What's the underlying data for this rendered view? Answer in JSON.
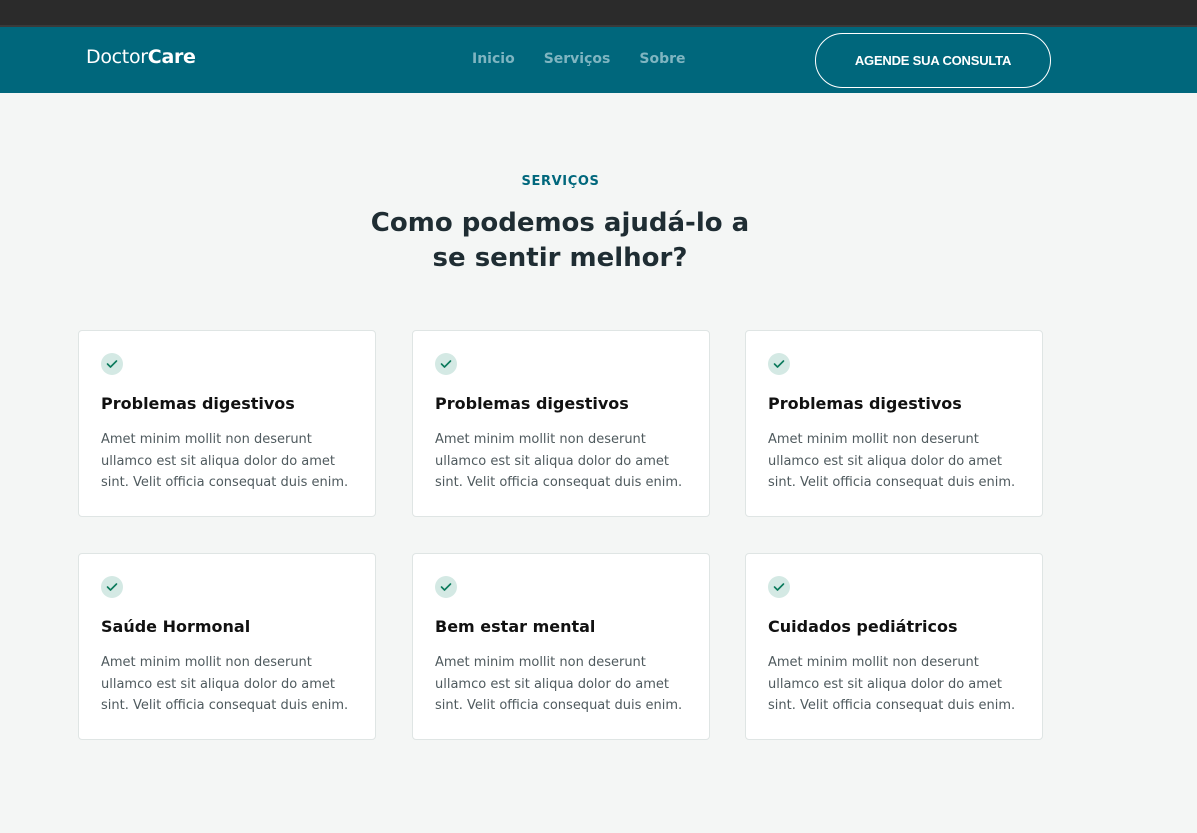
{
  "header": {
    "logo_regular": "Doctor",
    "logo_bold": "Care",
    "nav": [
      "Inicio",
      "Serviços",
      "Sobre"
    ],
    "cta_label": "AGENDE SUA CONSULTA"
  },
  "services": {
    "label": "SERVIÇOS",
    "title": "Como podemos ajudá-lo a se sentir melhor?",
    "cards": [
      {
        "icon": "check-icon",
        "title": "Problemas digestivos",
        "text": "Amet minim mollit non deserunt ullamco est sit aliqua dolor do amet sint. Velit officia consequat duis enim."
      },
      {
        "icon": "check-icon",
        "title": "Problemas digestivos",
        "text": "Amet minim mollit non deserunt ullamco est sit aliqua dolor do amet sint. Velit officia consequat duis enim."
      },
      {
        "icon": "check-icon",
        "title": "Problemas digestivos",
        "text": "Amet minim mollit non deserunt ullamco est sit aliqua dolor do amet sint. Velit officia consequat duis enim."
      },
      {
        "icon": "check-icon",
        "title": "Saúde Hormonal",
        "text": "Amet minim mollit non deserunt ullamco est sit aliqua dolor do amet sint. Velit officia consequat duis enim."
      },
      {
        "icon": "check-icon",
        "title": "Bem estar mental",
        "text": "Amet minim mollit non deserunt ullamco est sit aliqua dolor do amet sint. Velit officia consequat duis enim."
      },
      {
        "icon": "check-icon",
        "title": "Cuidados pediátricos",
        "text": "Amet minim mollit non deserunt ullamco est sit aliqua dolor do amet sint. Velit officia consequat duis enim."
      }
    ]
  },
  "colors": {
    "brand": "#00677c",
    "background": "#f4f6f5",
    "check_bg": "#d4e9e4",
    "check_mark": "#0b7a5c"
  }
}
